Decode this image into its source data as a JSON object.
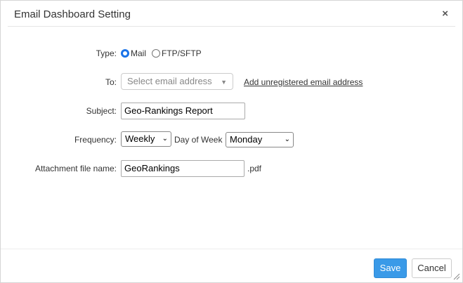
{
  "dialog": {
    "title": "Email Dashboard Setting",
    "close_icon": "×"
  },
  "form": {
    "type": {
      "label": "Type:",
      "options": [
        {
          "label": "Mail",
          "checked": true
        },
        {
          "label": "FTP/SFTP",
          "checked": false
        }
      ]
    },
    "to": {
      "label": "To:",
      "placeholder": "Select email address",
      "link": "Add unregistered email address"
    },
    "subject": {
      "label": "Subject:",
      "value": "Geo-Rankings Report"
    },
    "frequency": {
      "label": "Frequency:",
      "value": "Weekly",
      "day_label": "Day of Week",
      "day_value": "Monday"
    },
    "attachment": {
      "label": "Attachment file name:",
      "value": "GeoRankings",
      "suffix": ".pdf"
    }
  },
  "footer": {
    "save_label": "Save",
    "cancel_label": "Cancel"
  },
  "colors": {
    "accent": "#3a9ae8",
    "radio_checked": "#1a73e8"
  }
}
